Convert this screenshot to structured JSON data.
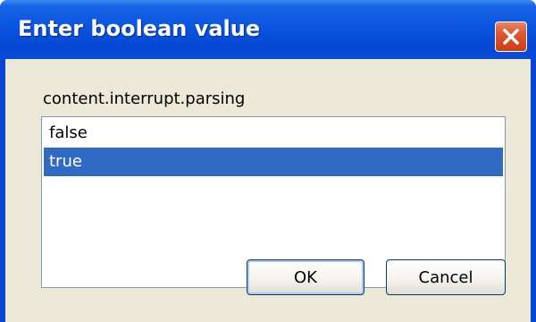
{
  "dialog": {
    "title": "Enter boolean value",
    "close_icon": "close-icon",
    "prompt_label": "content.interrupt.parsing",
    "options": [
      {
        "label": "false",
        "selected": false
      },
      {
        "label": "true",
        "selected": true
      }
    ],
    "ok_label": "OK",
    "cancel_label": "Cancel"
  },
  "colors": {
    "titlebar": "#0a55e0",
    "selection": "#316ac5",
    "client": "#ece9d8",
    "close_button": "#e0562e"
  }
}
